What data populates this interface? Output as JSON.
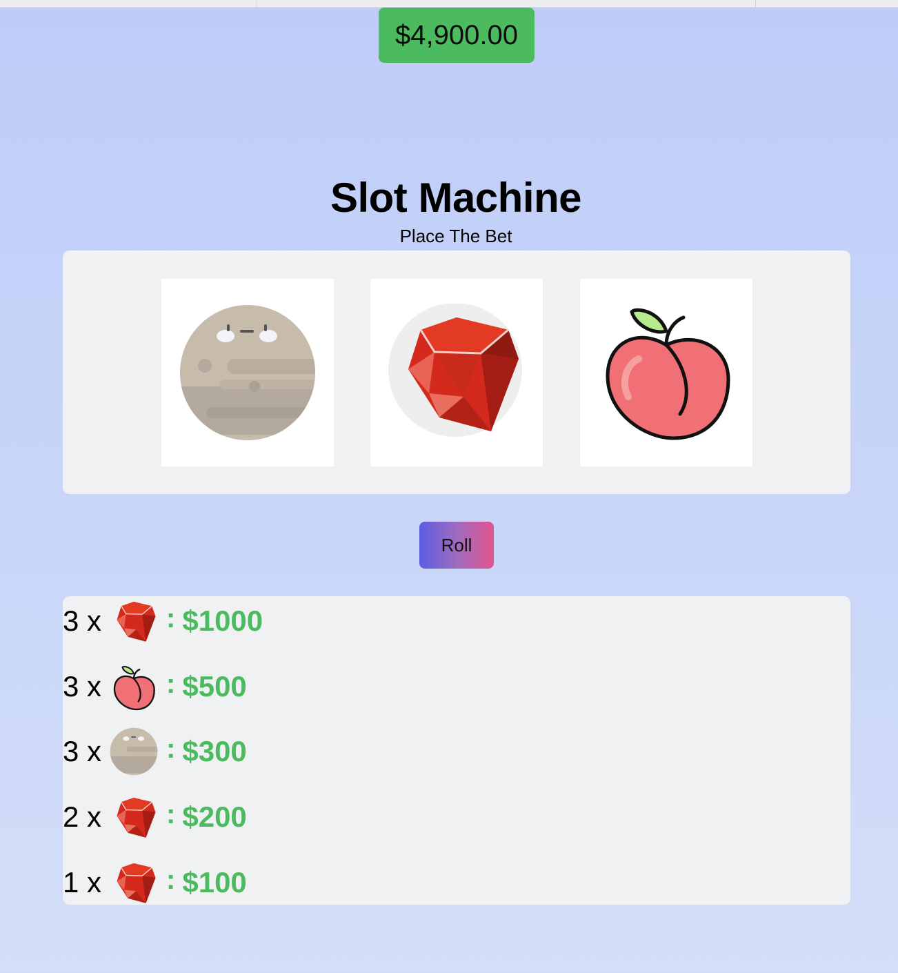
{
  "balance": "$4,900.00",
  "title": "Slot Machine",
  "subtitle": "Place The Bet",
  "reels": [
    "moon",
    "ruby",
    "peach"
  ],
  "roll_label": "Roll",
  "payouts": [
    {
      "count": "3 x",
      "symbol": "ruby",
      "colon": ":",
      "amount": "$1000"
    },
    {
      "count": "3 x",
      "symbol": "peach",
      "colon": ":",
      "amount": "$500"
    },
    {
      "count": "3 x",
      "symbol": "moon",
      "colon": ":",
      "amount": "$300"
    },
    {
      "count": "2 x",
      "symbol": "ruby",
      "colon": ":",
      "amount": "$200"
    },
    {
      "count": "1 x",
      "symbol": "ruby",
      "colon": ":",
      "amount": "$100"
    }
  ],
  "colors": {
    "balance_bg": "#4cba5f",
    "payout_text": "#4cba5f",
    "panel_bg": "#f0f1f3",
    "roll_gradient": [
      "#5a5ee0",
      "#e2558f"
    ]
  }
}
